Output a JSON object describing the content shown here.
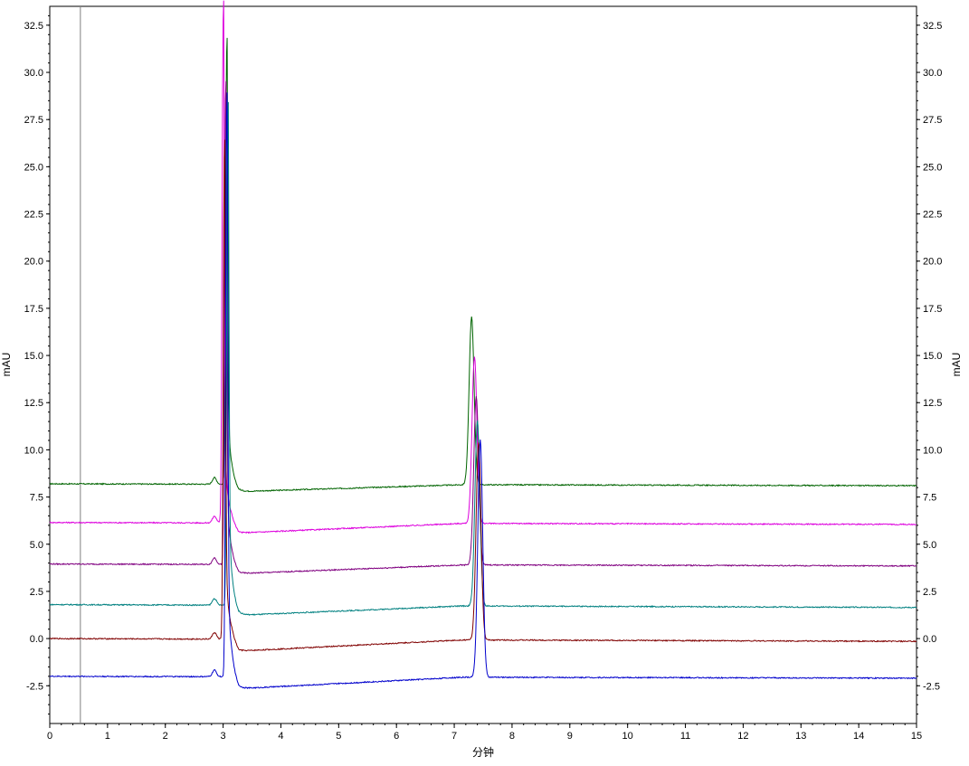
{
  "chart_data": {
    "type": "line",
    "xlabel": "分钟",
    "ylabel_left": "mAU",
    "ylabel_right": "mAU",
    "xlim": [
      0,
      15
    ],
    "ylim": [
      -4.5,
      33.5
    ],
    "x_ticks": [
      0,
      1,
      2,
      3,
      4,
      5,
      6,
      7,
      8,
      9,
      10,
      11,
      12,
      13,
      14,
      15
    ],
    "y_ticks": [
      -2.5,
      0.0,
      2.5,
      5.0,
      7.5,
      10.0,
      12.5,
      15.0,
      17.5,
      20.0,
      22.5,
      25.0,
      27.5,
      30.0,
      32.5
    ],
    "x_tick_labels": [
      "0",
      "1",
      "2",
      "3",
      "4",
      "5",
      "6",
      "7",
      "8",
      "9",
      "10",
      "11",
      "12",
      "13",
      "14",
      "15"
    ],
    "y_tick_labels": [
      "-2.5",
      "0.0",
      "2.5",
      "5.0",
      "7.5",
      "10.0",
      "12.5",
      "15.0",
      "17.5",
      "20.0",
      "22.5",
      "25.0",
      "27.5",
      "30.0",
      "32.5"
    ],
    "grid": false,
    "marker_line_x": 0.53,
    "series": [
      {
        "color": "#006400",
        "baseline_start": 8.2,
        "baseline_end": 8.1,
        "dip_level": 7.8,
        "peak1": {
          "x": 3.06,
          "y": 31.0
        },
        "peak2": {
          "x": 7.3,
          "y": 17.0
        }
      },
      {
        "color": "#dd00dd",
        "baseline_start": 6.15,
        "baseline_end": 6.05,
        "dip_level": 5.6,
        "peak1": {
          "x": 3.0,
          "y": 32.8
        },
        "peak2": {
          "x": 7.35,
          "y": 14.9
        }
      },
      {
        "color": "#800080",
        "baseline_start": 3.95,
        "baseline_end": 3.85,
        "dip_level": 3.45,
        "peak1": {
          "x": 3.04,
          "y": 28.6
        },
        "peak2": {
          "x": 7.38,
          "y": 12.8
        }
      },
      {
        "color": "#008080",
        "baseline_start": 1.8,
        "baseline_end": 1.65,
        "dip_level": 1.25,
        "peak1": {
          "x": 3.08,
          "y": 27.5
        },
        "peak2": {
          "x": 7.4,
          "y": 11.5
        }
      },
      {
        "color": "#800000",
        "baseline_start": 0.0,
        "baseline_end": -0.15,
        "dip_level": -0.65,
        "peak1": {
          "x": 3.02,
          "y": 25.5
        },
        "peak2": {
          "x": 7.42,
          "y": 10.3
        }
      },
      {
        "color": "#0000cc",
        "baseline_start": -2.0,
        "baseline_end": -2.1,
        "dip_level": -2.65,
        "peak1": {
          "x": 3.06,
          "y": 27.8
        },
        "peak2": {
          "x": 7.45,
          "y": 10.5
        }
      }
    ]
  }
}
